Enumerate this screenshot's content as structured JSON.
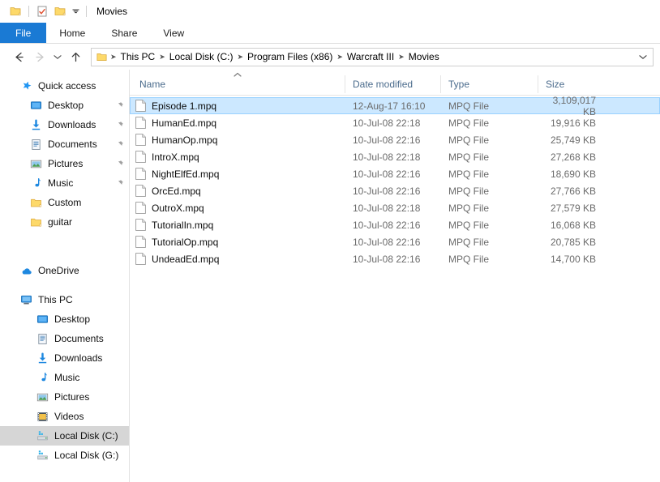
{
  "window": {
    "title": "Movies",
    "quick_access_toolbar": [
      {
        "name": "folder-icon",
        "label": "Properties folder"
      },
      {
        "name": "properties-icon",
        "label": "Properties"
      },
      {
        "name": "new-folder-icon",
        "label": "New folder"
      },
      {
        "name": "chevron-down-icon",
        "label": "Customize Quick Access Toolbar"
      }
    ]
  },
  "ribbon": {
    "tabs": [
      {
        "label": "File",
        "active": true
      },
      {
        "label": "Home",
        "active": false
      },
      {
        "label": "Share",
        "active": false
      },
      {
        "label": "View",
        "active": false
      }
    ]
  },
  "address_bar": {
    "back_icon": "back-arrow-icon",
    "forward_icon": "forward-arrow-icon",
    "recent_icon": "recent-locations-chevron-icon",
    "up_icon": "up-arrow-icon",
    "dropdown_icon": "address-dropdown-chevron-icon",
    "breadcrumbs": [
      "This PC",
      "Local Disk (C:)",
      "Program Files (x86)",
      "Warcraft III",
      "Movies"
    ]
  },
  "navigation_pane": {
    "groups": [
      {
        "header": {
          "label": "Quick access",
          "icon": "quick-access-star-icon"
        },
        "items": [
          {
            "label": "Desktop",
            "icon": "desktop-icon",
            "pinned": true
          },
          {
            "label": "Downloads",
            "icon": "downloads-icon",
            "pinned": true
          },
          {
            "label": "Documents",
            "icon": "documents-icon",
            "pinned": true
          },
          {
            "label": "Pictures",
            "icon": "pictures-icon",
            "pinned": true
          },
          {
            "label": "Music",
            "icon": "music-icon",
            "pinned": true
          },
          {
            "label": "Custom",
            "icon": "folder-icon",
            "pinned": false
          },
          {
            "label": "guitar",
            "icon": "folder-icon",
            "pinned": false
          }
        ]
      },
      {
        "header": {
          "label": "OneDrive",
          "icon": "onedrive-cloud-icon"
        },
        "items": []
      },
      {
        "header": {
          "label": "This PC",
          "icon": "this-pc-icon"
        },
        "items": [
          {
            "label": "Desktop",
            "icon": "desktop-icon",
            "pinned": false
          },
          {
            "label": "Documents",
            "icon": "documents-icon",
            "pinned": false
          },
          {
            "label": "Downloads",
            "icon": "downloads-icon",
            "pinned": false
          },
          {
            "label": "Music",
            "icon": "music-icon",
            "pinned": false
          },
          {
            "label": "Pictures",
            "icon": "pictures-icon",
            "pinned": false
          },
          {
            "label": "Videos",
            "icon": "videos-icon",
            "pinned": false
          },
          {
            "label": "Local Disk (C:)",
            "icon": "drive-icon",
            "pinned": false,
            "selected": true
          },
          {
            "label": "Local Disk (G:)",
            "icon": "drive-icon",
            "pinned": false
          }
        ]
      }
    ]
  },
  "file_list": {
    "columns": [
      {
        "label": "Name",
        "sort": "ascending"
      },
      {
        "label": "Date modified",
        "sort": null
      },
      {
        "label": "Type",
        "sort": null
      },
      {
        "label": "Size",
        "sort": null
      }
    ],
    "rows": [
      {
        "name": "Episode 1.mpq",
        "date": "12-Aug-17 16:10",
        "type": "MPQ File",
        "size": "3,109,017 KB",
        "selected": true
      },
      {
        "name": "HumanEd.mpq",
        "date": "10-Jul-08 22:18",
        "type": "MPQ File",
        "size": "19,916 KB",
        "selected": false
      },
      {
        "name": "HumanOp.mpq",
        "date": "10-Jul-08 22:16",
        "type": "MPQ File",
        "size": "25,749 KB",
        "selected": false
      },
      {
        "name": "IntroX.mpq",
        "date": "10-Jul-08 22:18",
        "type": "MPQ File",
        "size": "27,268 KB",
        "selected": false
      },
      {
        "name": "NightElfEd.mpq",
        "date": "10-Jul-08 22:16",
        "type": "MPQ File",
        "size": "18,690 KB",
        "selected": false
      },
      {
        "name": "OrcEd.mpq",
        "date": "10-Jul-08 22:16",
        "type": "MPQ File",
        "size": "27,766 KB",
        "selected": false
      },
      {
        "name": "OutroX.mpq",
        "date": "10-Jul-08 22:18",
        "type": "MPQ File",
        "size": "27,579 KB",
        "selected": false
      },
      {
        "name": "TutorialIn.mpq",
        "date": "10-Jul-08 22:16",
        "type": "MPQ File",
        "size": "16,068 KB",
        "selected": false
      },
      {
        "name": "TutorialOp.mpq",
        "date": "10-Jul-08 22:16",
        "type": "MPQ File",
        "size": "20,785 KB",
        "selected": false
      },
      {
        "name": "UndeadEd.mpq",
        "date": "10-Jul-08 22:16",
        "type": "MPQ File",
        "size": "14,700 KB",
        "selected": false
      }
    ]
  },
  "colors": {
    "accent": "#1a7ad4",
    "selection_fill": "#cce8ff",
    "selection_border": "#99d1ff",
    "nav_selection": "#d6d6d6",
    "header_text": "#4a6b8c",
    "folder_yellow": "#fdd96a"
  }
}
